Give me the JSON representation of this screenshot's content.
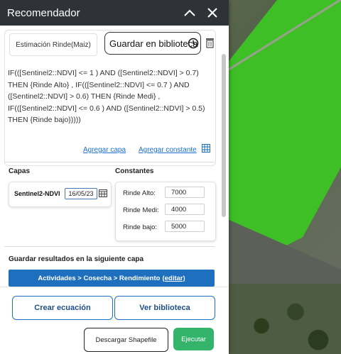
{
  "window": {
    "title": "Recomendador"
  },
  "top": {
    "recipe_name": "Estimación Rinde(Maiz)",
    "save_library_label": "Guardar en biblioteca",
    "formula": "IF(([Sentinel2::NDVI] <= 1 ) AND ([Sentinel2::NDVI] > 0.7) THEN  {Rinde Alto} , IF(([Sentinel2::NDVI] <= 0.7 ) AND ([Sentinel2::NDVI] > 0.6) THEN {Rinde Medi} , IF(([Sentinel2::NDVI] <= 0.6 ) AND ([Sentinel2::NDVI] > 0.5) THEN {Rinde bajo}))))",
    "add_layer_link": "Agregar capa",
    "add_constant_link": "Agregar constante"
  },
  "layers": {
    "label": "Capas",
    "items": [
      {
        "name": "Sentinel2-NDVI",
        "date": "16/05/23"
      }
    ]
  },
  "constants": {
    "label": "Constantes",
    "items": [
      {
        "name": "Rinde Alto:",
        "value": "7000"
      },
      {
        "name": "Rinde Medi:",
        "value": "4000"
      },
      {
        "name": "Rinde bajo:",
        "value": "5000"
      }
    ]
  },
  "save_results": {
    "label": "Guardar resultados en la siguiente capa",
    "path": "Actividades > Cosecha > Rendimiento",
    "edit_label": "(editar)"
  },
  "actions": {
    "create_equation": "Crear ecuación",
    "view_library": "Ver biblioteca",
    "download_shapefile": "Descargar Shapefile",
    "run": "Ejecutar"
  },
  "colors": {
    "accent": "#1e6fbe",
    "run": "#33b46a",
    "titlebar": "#2f3338"
  }
}
